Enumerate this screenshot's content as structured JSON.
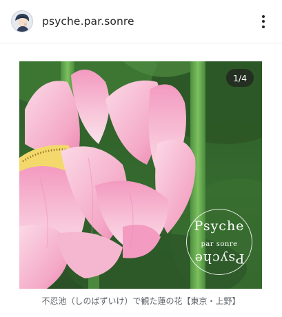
{
  "header": {
    "username": "psyche.par.sonre",
    "more_icon": "more-vertical-icon",
    "avatar_icon": "avatar-portrait"
  },
  "post": {
    "counter": "1/4",
    "current_index": 1,
    "total_images": 4,
    "photo_subject": "pink lotus flower",
    "watermark": {
      "top": "Psyche",
      "middle": "par sonre",
      "bottom": "Psyche"
    },
    "caption": "不忍池（しのばずいけ）で観た蓮の花【東京・上野】"
  },
  "colors": {
    "text_primary": "#262626",
    "caption_text": "#5f6368",
    "counter_bg": "#202020",
    "leaf_green": "#3f7a34",
    "petal_pink": "#f2a6c4"
  }
}
